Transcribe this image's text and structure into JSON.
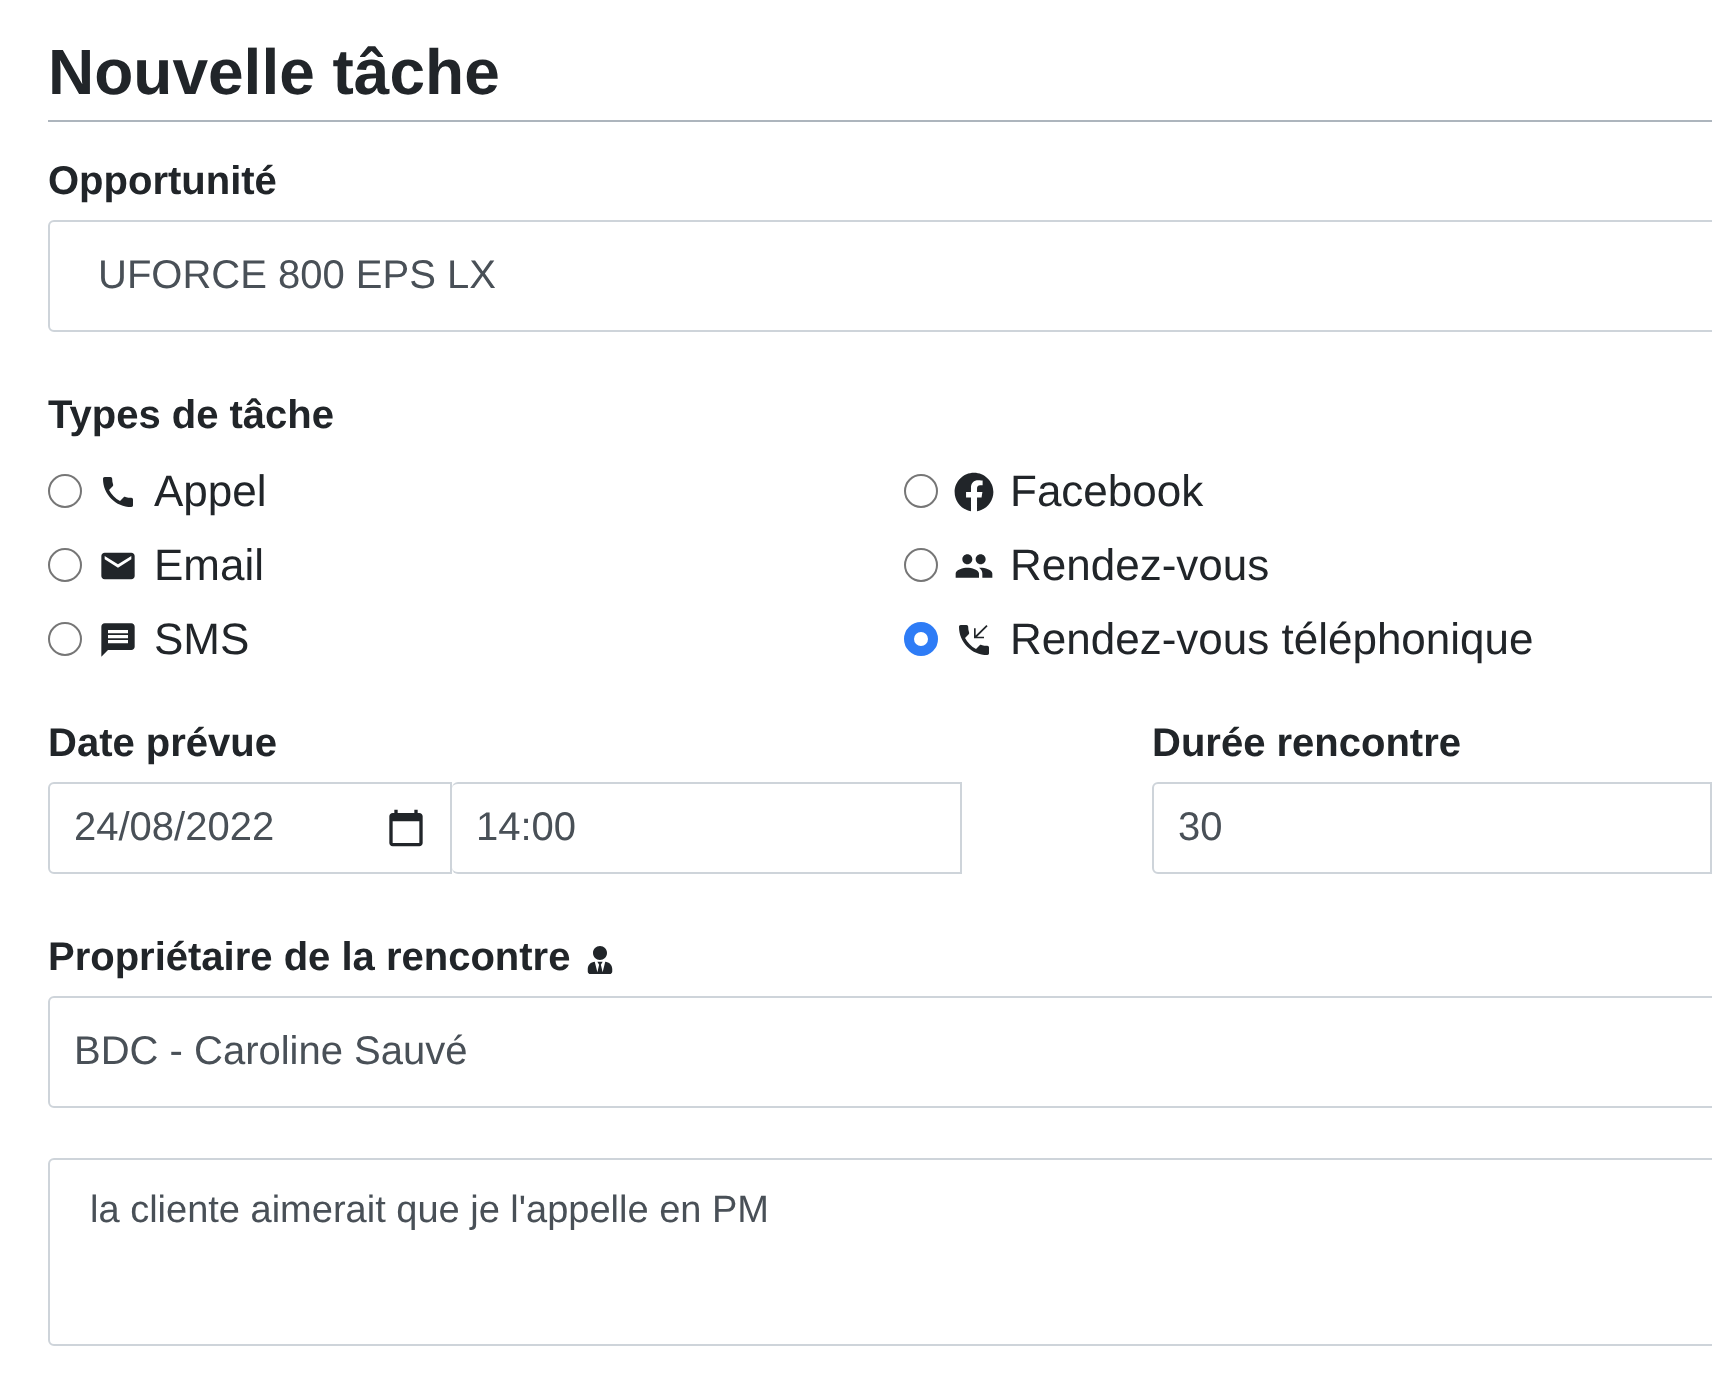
{
  "title": "Nouvelle tâche",
  "opportunity": {
    "label": "Opportunité",
    "value": "UFORCE 800 EPS LX"
  },
  "task_types": {
    "label": "Types de tâche",
    "options": [
      {
        "label": "Appel",
        "selected": false
      },
      {
        "label": "Facebook",
        "selected": false
      },
      {
        "label": "Email",
        "selected": false
      },
      {
        "label": "Rendez-vous",
        "selected": false
      },
      {
        "label": "SMS",
        "selected": false
      },
      {
        "label": "Rendez-vous téléphonique",
        "selected": true
      }
    ]
  },
  "date": {
    "label": "Date prévue",
    "date": "24/08/2022",
    "time": "14:00"
  },
  "duration": {
    "label": "Durée rencontre",
    "value": "30"
  },
  "owner": {
    "label": "Propriétaire de la rencontre",
    "value": "BDC - Caroline Sauvé"
  },
  "notes": {
    "value": "la cliente aimerait que je l'appelle en PM"
  }
}
